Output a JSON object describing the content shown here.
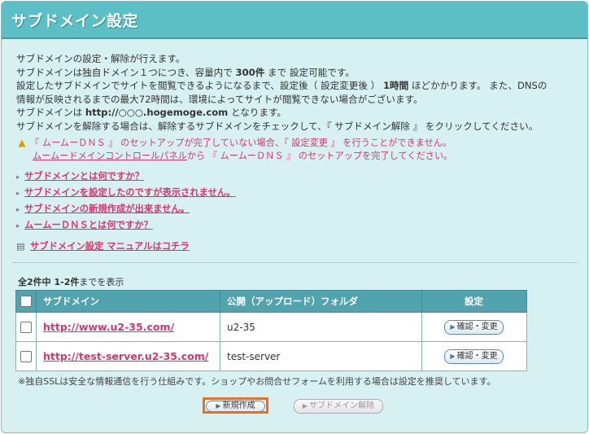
{
  "header": {
    "title": "サブドメイン設定"
  },
  "intro": {
    "line1": "サブドメインの設定・解除が行えます。",
    "line2_pre": "サブドメインは独自ドメイン１つにつき、容量内で ",
    "line2_bold": "300件",
    "line2_post": " まで 設定可能です。",
    "line3_pre": "設定したサブドメインでサイトを閲覧できるようになるまで、設定後（ 設定変更後 ） ",
    "line3_bold": "1時間",
    "line3_post": " ほどかかります。 また、DNSの",
    "line4": "情報が反映されるまでの最大72時間は、環境によってサイトが閲覧できない場合がございます。",
    "line5_pre": "サブドメインは ",
    "line5_bold": "http://○○○.hogemoge.com",
    "line5_post": " となります。",
    "line6": "サブドメインを解除する場合は、解除するサブドメインをチェックして、『 サブドメイン解除 』 をクリックしてください。"
  },
  "warning": {
    "line1": "『 ムームーＤＮＳ 』 のセットアップが完了していない場合、『 設定変更 』 を行うことができません。",
    "link": "ムームードメインコントロールパネル",
    "line2_post": "から 『 ムームーＤＮＳ 』 のセットアップを完了してください。"
  },
  "help_links": [
    "サブドメインとは何ですか？",
    "サブドメインを設定したのですが表示されません。",
    "サブドメインの新規作成が出来ません。",
    "ムームーＤＮＳとは何ですか？"
  ],
  "manual_link": "サブドメイン設定 マニュアルはコチラ",
  "count": {
    "range": "全2件中 1-2件",
    "suffix": "までを表示"
  },
  "table": {
    "headers": {
      "domain": "サブドメイン",
      "folder": "公開（アップロード）フォルダ",
      "settings": "設定"
    },
    "rows": [
      {
        "domain": "http://www.u2-35.com/",
        "folder": "u2-35",
        "action": "確認・変更"
      },
      {
        "domain": "http://test-server.u2-35.com/",
        "folder": "test-server",
        "action": "確認・変更"
      }
    ]
  },
  "note": "※独自SSLは安全な情報通信を行う仕組みです。ショップやお問合せフォームを利用する場合は設定を推奨しています。",
  "buttons": {
    "new": "新規作成",
    "delete": "サブドメイン解除"
  },
  "colors": {
    "accent_link": "#e0336b",
    "header": "#5cbfc6",
    "highlight": "#f26c21"
  }
}
